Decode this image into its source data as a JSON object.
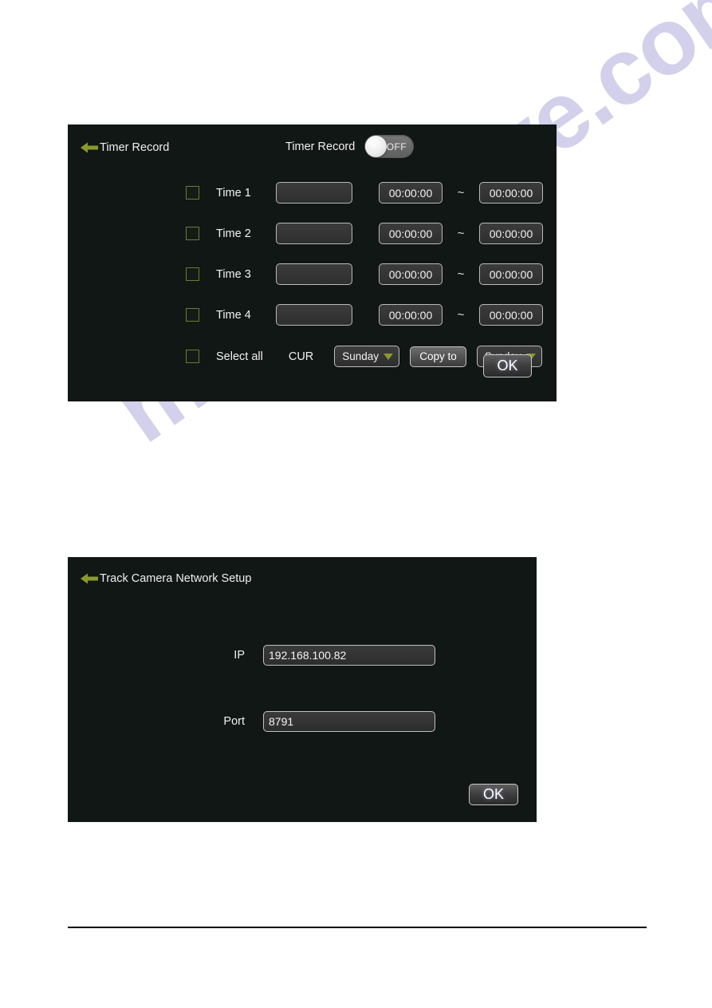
{
  "watermark": {
    "text": "manualshive.com",
    "color": "#3a2fa8"
  },
  "timer_panel": {
    "back_title": "Timer Record",
    "toggle": {
      "label": "Timer Record",
      "state": "OFF",
      "on": false
    },
    "rows": [
      {
        "label": "Time 1",
        "name": "",
        "start": "00:00:00",
        "sep": "~",
        "end": "00:00:00",
        "checked": false
      },
      {
        "label": "Time 2",
        "name": "",
        "start": "00:00:00",
        "sep": "~",
        "end": "00:00:00",
        "checked": false
      },
      {
        "label": "Time 3",
        "name": "",
        "start": "00:00:00",
        "sep": "~",
        "end": "00:00:00",
        "checked": false
      },
      {
        "label": "Time 4",
        "name": "",
        "start": "00:00:00",
        "sep": "~",
        "end": "00:00:00",
        "checked": false
      }
    ],
    "bottom": {
      "select_all": "Select all",
      "cur_label": "CUR",
      "source_day": "Sunday",
      "copy_to": "Copy to",
      "target_day": "Sunday",
      "ok": "OK"
    }
  },
  "network_panel": {
    "back_title": "Track Camera Network Setup",
    "ip_label": "IP",
    "ip_value": "192.168.100.82",
    "port_label": "Port",
    "port_value": "8791",
    "ok": "OK"
  }
}
